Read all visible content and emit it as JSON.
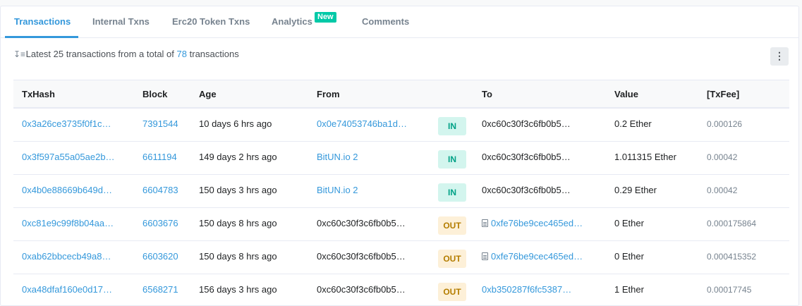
{
  "tabs": [
    {
      "label": "Transactions",
      "active": true
    },
    {
      "label": "Internal Txns",
      "active": false
    },
    {
      "label": "Erc20 Token Txns",
      "active": false
    },
    {
      "label": "Analytics",
      "active": false,
      "badge": "New"
    },
    {
      "label": "Comments",
      "active": false
    }
  ],
  "summary": {
    "prefix": "Latest 25 transactions from a total of",
    "total": "78",
    "suffix": "transactions",
    "sort_icon": "sort-descending-icon"
  },
  "more_button_icon": "vertical-ellipsis-icon",
  "columns": [
    "TxHash",
    "Block",
    "Age",
    "From",
    "",
    "To",
    "Value",
    "[TxFee]"
  ],
  "rows": [
    {
      "txhash": "0x3a26ce3735f0f1c…",
      "block": "7391544",
      "age": "10 days 6 hrs ago",
      "from": "0x0e74053746ba1d…",
      "from_link": true,
      "dir": "IN",
      "to": "0xc60c30f3c6fb0b5…",
      "to_link": false,
      "to_contract": false,
      "value": "0.2 Ether",
      "fee": "0.000126"
    },
    {
      "txhash": "0x3f597a55a05ae2b…",
      "block": "6611194",
      "age": "149 days 2 hrs ago",
      "from": "BitUN.io 2",
      "from_link": true,
      "dir": "IN",
      "to": "0xc60c30f3c6fb0b5…",
      "to_link": false,
      "to_contract": false,
      "value": "1.011315 Ether",
      "fee": "0.00042"
    },
    {
      "txhash": "0x4b0e88669b649d…",
      "block": "6604783",
      "age": "150 days 3 hrs ago",
      "from": "BitUN.io 2",
      "from_link": true,
      "dir": "IN",
      "to": "0xc60c30f3c6fb0b5…",
      "to_link": false,
      "to_contract": false,
      "value": "0.29 Ether",
      "fee": "0.00042"
    },
    {
      "txhash": "0xc81e9c99f8b04aa…",
      "block": "6603676",
      "age": "150 days 8 hrs ago",
      "from": "0xc60c30f3c6fb0b5…",
      "from_link": false,
      "dir": "OUT",
      "to": "0xfe76be9cec465ed…",
      "to_link": true,
      "to_contract": true,
      "value": "0 Ether",
      "fee": "0.000175864"
    },
    {
      "txhash": "0xab62bbcecb49a8…",
      "block": "6603620",
      "age": "150 days 8 hrs ago",
      "from": "0xc60c30f3c6fb0b5…",
      "from_link": false,
      "dir": "OUT",
      "to": "0xfe76be9cec465ed…",
      "to_link": true,
      "to_contract": true,
      "value": "0 Ether",
      "fee": "0.000415352"
    },
    {
      "txhash": "0xa48dfaf160e0d17…",
      "block": "6568271",
      "age": "156 days 3 hrs ago",
      "from": "0xc60c30f3c6fb0b5…",
      "from_link": false,
      "dir": "OUT",
      "to": "0xb350287f6fc5387…",
      "to_link": true,
      "to_contract": false,
      "value": "1 Ether",
      "fee": "0.00017745"
    }
  ],
  "colors": {
    "accent": "#3498db",
    "in_bg": "#d3f5ee",
    "in_text": "#00a186",
    "out_bg": "#fdf0d8",
    "out_text": "#b47d00",
    "badge_new": "#00c9a7"
  }
}
